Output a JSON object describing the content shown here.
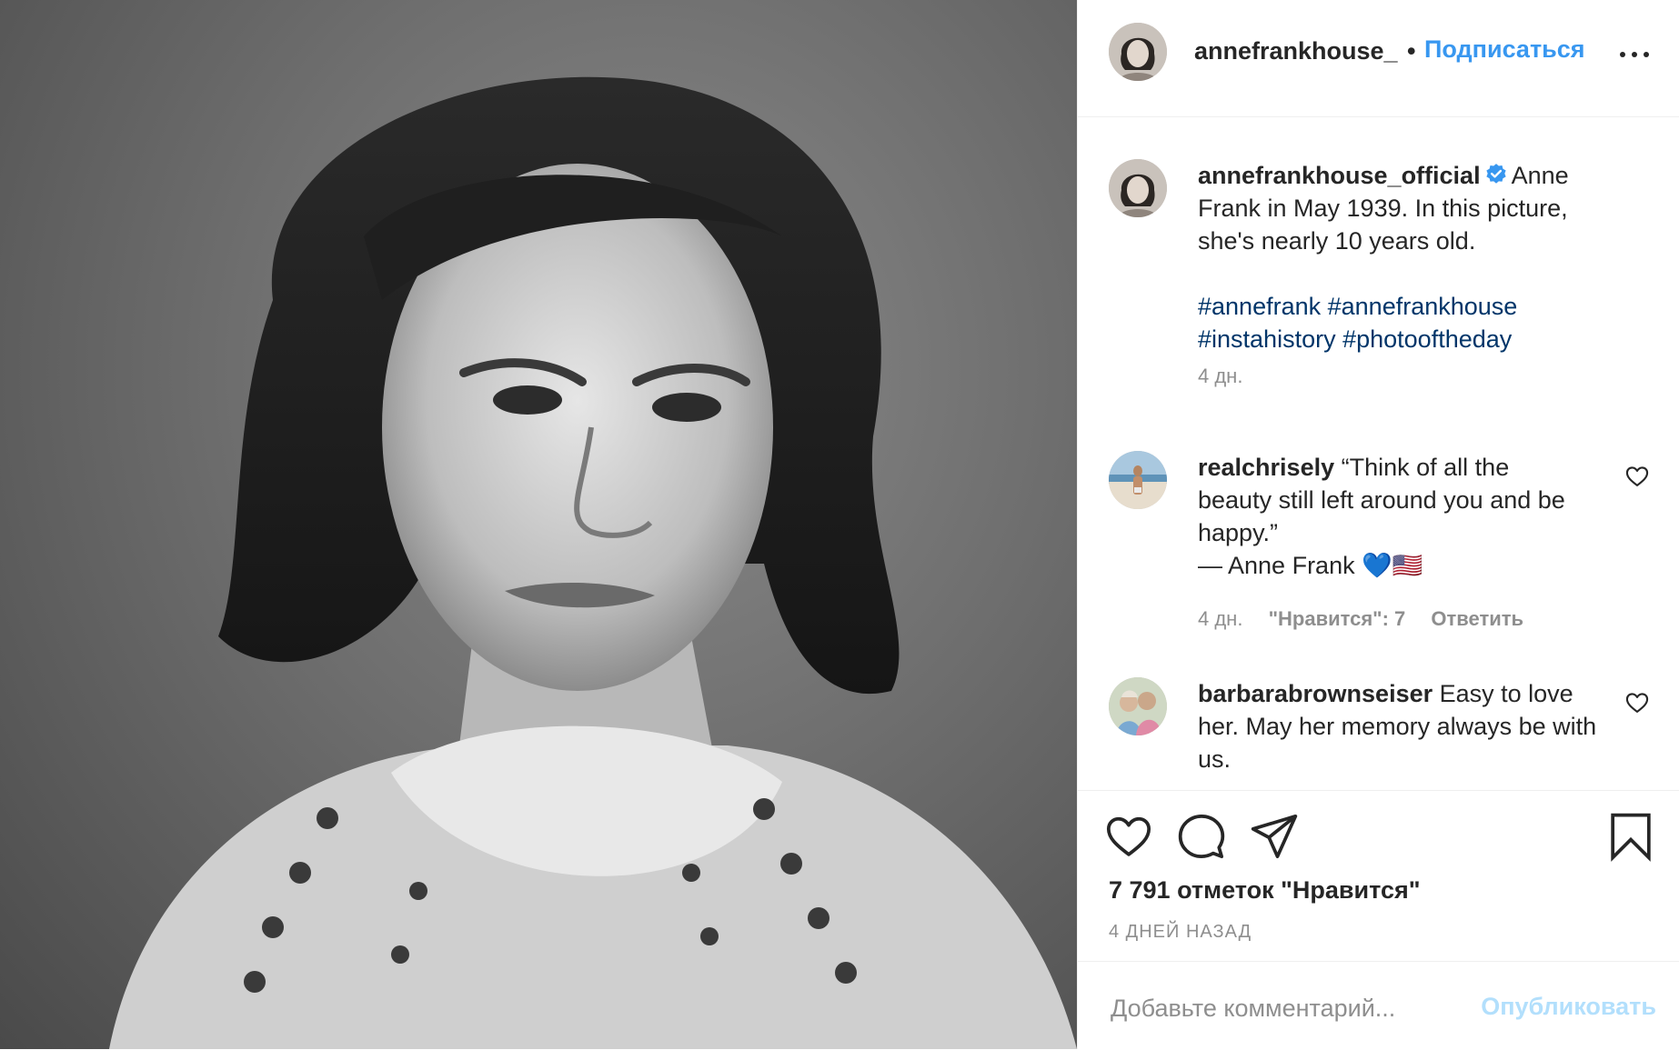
{
  "post": {
    "header": {
      "username": "annefrankhouse_",
      "separator": "•",
      "follow_label": "Подписаться"
    },
    "caption": {
      "username": "annefrankhouse_official",
      "text": "Anne Frank in May 1939. In this picture, she's nearly 10 years old.",
      "hashtags": [
        "#annefrank",
        "#annefrankhouse",
        "#instahistory",
        "#photooftheday"
      ],
      "time": "4 дн."
    },
    "comments": [
      {
        "username": "realchrisely",
        "text_lines": [
          "“Think of all the",
          "beauty still left around you and be",
          "happy.”",
          "— Anne Frank 💙🇺🇸"
        ],
        "time": "4 дн.",
        "likes": "\"Нравится\": 7",
        "reply_label": "Ответить"
      },
      {
        "username": "barbarabrownseiser",
        "text": "Easy to love her. May her memory always be with us."
      }
    ],
    "likes_count": "7 791 отметок \"Нравится\"",
    "posted_ago": "4 дней назад",
    "compose": {
      "placeholder": "Добавьте комментарий...",
      "post_label": "Опубликовать"
    }
  },
  "colors": {
    "link_blue": "#3897f0",
    "hashtag": "#003569",
    "muted": "#8e8e8e",
    "post_disabled": "#b2dffc"
  },
  "icons": [
    "verified-badge-icon",
    "more-icon",
    "heart-icon",
    "comment-icon",
    "share-icon",
    "bookmark-icon"
  ]
}
